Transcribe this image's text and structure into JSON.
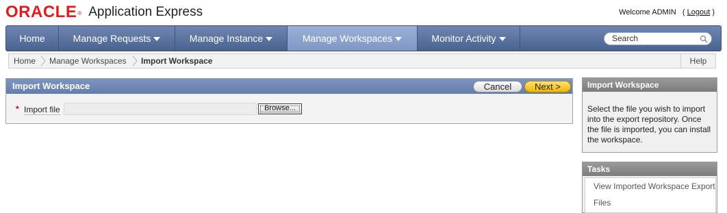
{
  "header": {
    "logo_text": "ORACLE",
    "logo_reg": "®",
    "app_name": "Application Express",
    "welcome_text": "Welcome ADMIN",
    "logout_open": "(",
    "logout_label": "Logout",
    "logout_close": ")"
  },
  "nav": {
    "tabs": [
      {
        "label": "Home"
      },
      {
        "label": "Manage Requests"
      },
      {
        "label": "Manage Instance"
      },
      {
        "label": "Manage Workspaces"
      },
      {
        "label": "Monitor Activity"
      }
    ],
    "search_placeholder": "Search"
  },
  "breadcrumb": {
    "items": [
      "Home",
      "Manage Workspaces",
      "Import Workspace"
    ],
    "help": "Help"
  },
  "region": {
    "title": "Import Workspace",
    "cancel_label": "Cancel",
    "next_label": "Next >",
    "required_mark": "*",
    "field_label": "Import file",
    "browse_label": "Browse..."
  },
  "info": {
    "title": "Import Workspace",
    "text": "Select the file you wish to import into the export repository. Once the file is imported, you can install the workspace."
  },
  "tasks": {
    "title": "Tasks",
    "items": [
      "View Imported Workspace Export",
      "Files"
    ]
  },
  "colors": {
    "nav_bg": "#5b73a0",
    "nav_active": "#8da4cd",
    "oracle_red": "#e41a1c",
    "next_button": "#f5b400"
  }
}
